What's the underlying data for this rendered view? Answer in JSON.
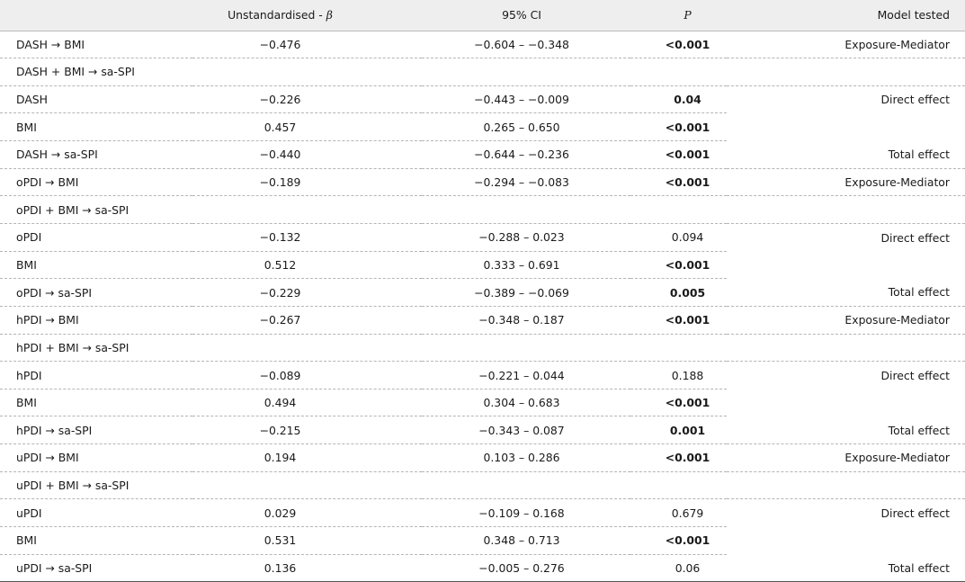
{
  "header": {
    "col1": "",
    "col2_text": "Unstandardised - ",
    "col2_symbol": "β",
    "col3": "95% CI",
    "col4": "P",
    "col5": "Model tested"
  },
  "rows": [
    {
      "label": "DASH → BMI",
      "beta": "−0.476",
      "ci": "−0.604 – −0.348",
      "p": "<0.001",
      "p_bold": true,
      "model": "Exposure-Mediator"
    },
    {
      "label": "DASH + BMI → sa-SPI",
      "beta": "",
      "ci": "",
      "p": "",
      "p_bold": false,
      "model": ""
    },
    {
      "label": "DASH",
      "beta": "−0.226",
      "ci": "−0.443 – −0.009",
      "p": "0.04",
      "p_bold": true,
      "model": "Direct effect"
    },
    {
      "label": "BMI",
      "beta": "0.457",
      "ci": "0.265 – 0.650",
      "p": "<0.001",
      "p_bold": true,
      "model": ""
    },
    {
      "label": "DASH → sa-SPI",
      "beta": "−0.440",
      "ci": "−0.644 – −0.236",
      "p": "<0.001",
      "p_bold": true,
      "model": "Total effect"
    },
    {
      "label": "oPDI → BMI",
      "beta": "−0.189",
      "ci": "−0.294 – −0.083",
      "p": "<0.001",
      "p_bold": true,
      "model": "Exposure-Mediator"
    },
    {
      "label": "oPDI + BMI → sa-SPI",
      "beta": "",
      "ci": "",
      "p": "",
      "p_bold": false,
      "model": ""
    },
    {
      "label": "oPDI",
      "beta": "−0.132",
      "ci": "−0.288 – 0.023",
      "p": "0.094",
      "p_bold": false,
      "model": "Direct effect"
    },
    {
      "label": "BMI",
      "beta": "0.512",
      "ci": "0.333 – 0.691",
      "p": "<0.001",
      "p_bold": true,
      "model": ""
    },
    {
      "label": "oPDI → sa-SPI",
      "beta": "−0.229",
      "ci": "−0.389 – −0.069",
      "p": "0.005",
      "p_bold": true,
      "model": "Total effect"
    },
    {
      "label": "hPDI → BMI",
      "beta": "−0.267",
      "ci": "−0.348 – 0.187",
      "p": "<0.001",
      "p_bold": true,
      "model": "Exposure-Mediator"
    },
    {
      "label": "hPDI + BMI → sa-SPI",
      "beta": "",
      "ci": "",
      "p": "",
      "p_bold": false,
      "model": ""
    },
    {
      "label": "hPDI",
      "beta": "−0.089",
      "ci": "−0.221 – 0.044",
      "p": "0.188",
      "p_bold": false,
      "model": "Direct effect"
    },
    {
      "label": "BMI",
      "beta": "0.494",
      "ci": "0.304 – 0.683",
      "p": "<0.001",
      "p_bold": true,
      "model": ""
    },
    {
      "label": "hPDI → sa-SPI",
      "beta": "−0.215",
      "ci": "−0.343 – 0.087",
      "p": "0.001",
      "p_bold": true,
      "model": "Total effect"
    },
    {
      "label": "uPDI → BMI",
      "beta": "0.194",
      "ci": "0.103 – 0.286",
      "p": "<0.001",
      "p_bold": true,
      "model": "Exposure-Mediator"
    },
    {
      "label": "uPDI + BMI → sa-SPI",
      "beta": "",
      "ci": "",
      "p": "",
      "p_bold": false,
      "model": ""
    },
    {
      "label": "uPDI",
      "beta": "0.029",
      "ci": "−0.109 – 0.168",
      "p": "0.679",
      "p_bold": false,
      "model": "Direct effect"
    },
    {
      "label": "BMI",
      "beta": "0.531",
      "ci": "0.348 – 0.713",
      "p": "<0.001",
      "p_bold": true,
      "model": ""
    },
    {
      "label": "uPDI → sa-SPI",
      "beta": "0.136",
      "ci": "−0.005 – 0.276",
      "p": "0.06",
      "p_bold": false,
      "model": "Total effect"
    }
  ]
}
